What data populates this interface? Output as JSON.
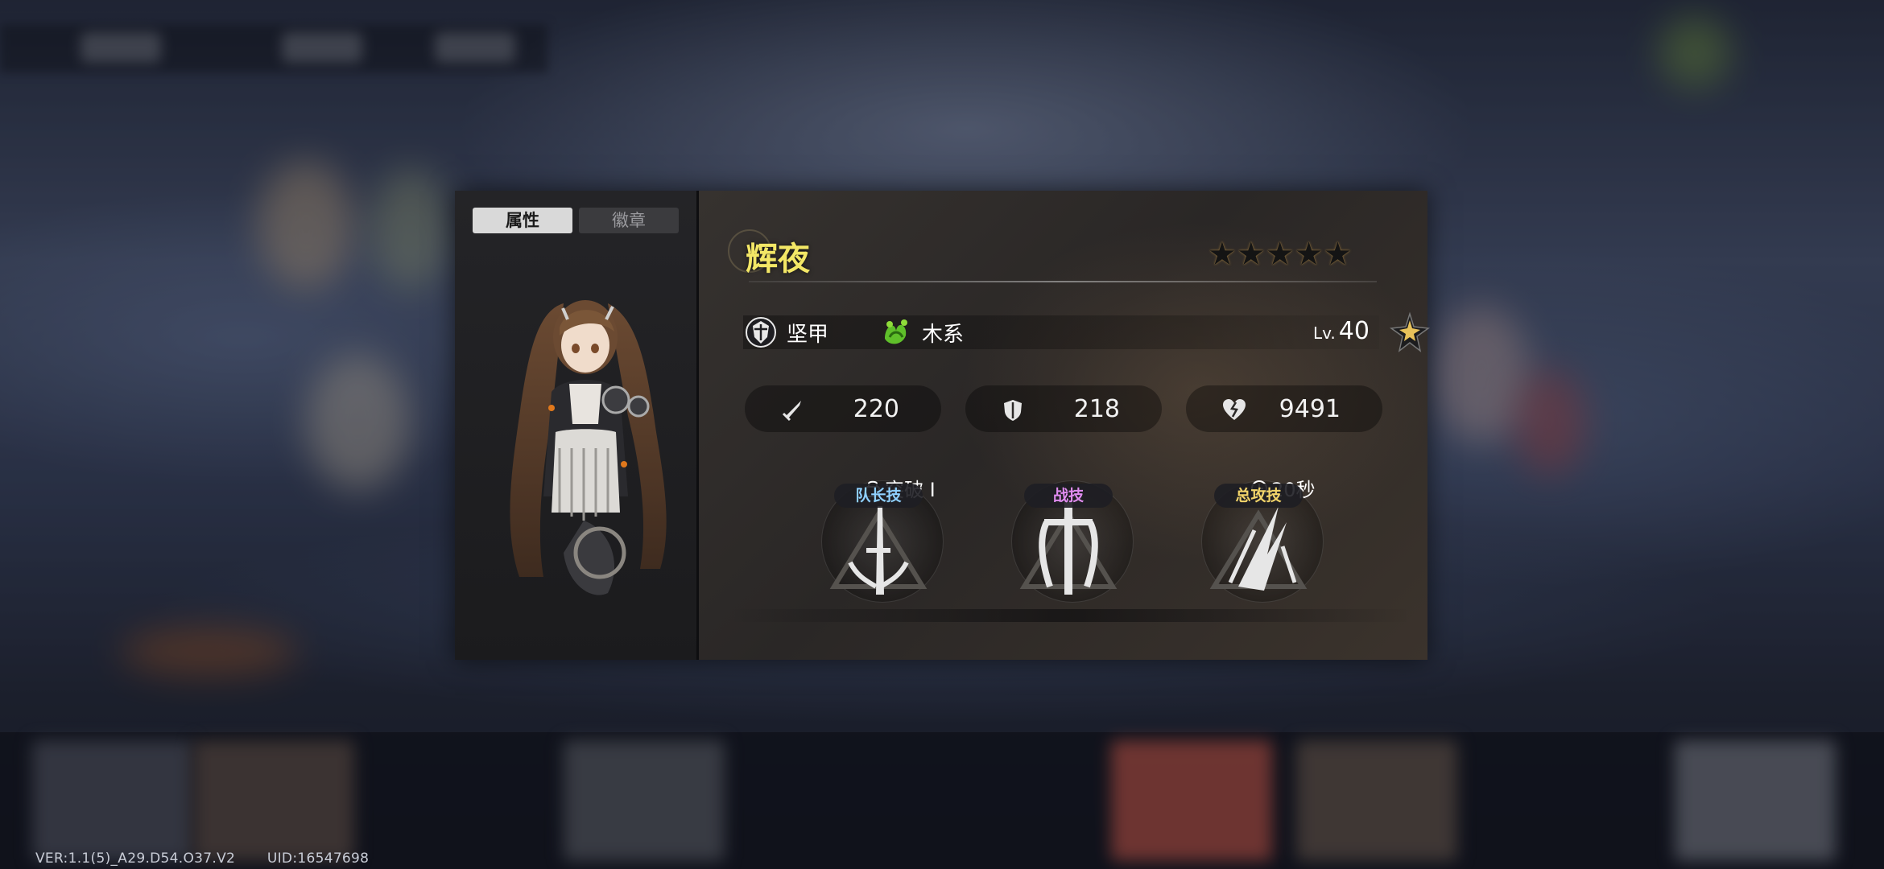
{
  "panel": {
    "tabs": [
      {
        "label": "属性",
        "active": true
      },
      {
        "label": "徽章",
        "active": false
      }
    ],
    "character": {
      "name": "辉夜",
      "rarity_stars": 5,
      "stars_text": "★★★★★",
      "class_label": "坚甲",
      "class_icon": "shield-emblem-icon",
      "element_label": "木系",
      "element_icon": "wood-element-icon",
      "level_prefix": "Lv.",
      "level": "40"
    },
    "stats": [
      {
        "icon": "sword-icon",
        "name": "attack",
        "value": "220"
      },
      {
        "icon": "shield-icon",
        "name": "defense",
        "value": "218"
      },
      {
        "icon": "heart-icon",
        "name": "hp",
        "value": "9491"
      }
    ],
    "skills": [
      {
        "label": "队长技",
        "label_color": "#8fd0ff",
        "tag": "突破 Ⅰ",
        "tag_icon": "lock-icon"
      },
      {
        "label": "战技",
        "label_color": "#e08cf0",
        "tag": "",
        "tag_icon": ""
      },
      {
        "label": "总攻技",
        "label_color": "#f2d46a",
        "tag": "20秒",
        "tag_icon": "clock-icon"
      }
    ]
  },
  "footer": {
    "version": "VER:1.1(5)_A29.D54.O37.V2",
    "uid": "UID:16547698"
  }
}
